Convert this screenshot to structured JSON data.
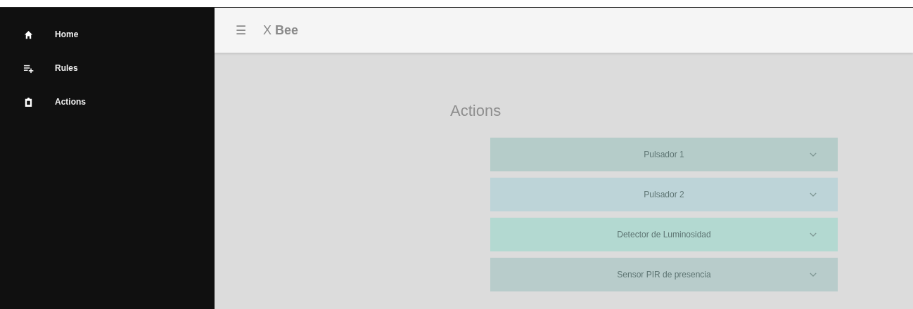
{
  "sidebar": {
    "items": [
      {
        "kind": "home",
        "label": "Home"
      },
      {
        "kind": "rules",
        "label": "Rules"
      },
      {
        "kind": "actions",
        "label": "Actions"
      }
    ]
  },
  "header": {
    "menu_icon": "☰",
    "title_prefix": "X",
    "title": "Bee"
  },
  "page_title": "Actions",
  "panels": [
    {
      "label": "Pulsador 1",
      "color": "#b5ccc9",
      "expanded": false
    },
    {
      "label": "Pulsador 2",
      "color": "#bdd4d8",
      "expanded": false
    },
    {
      "label": "Detector de Luminosidad",
      "color": "#b3d9d1",
      "expanded": false
    },
    {
      "label": "Sensor PIR de presencia",
      "color": "#b8cccb",
      "expanded": false
    }
  ]
}
